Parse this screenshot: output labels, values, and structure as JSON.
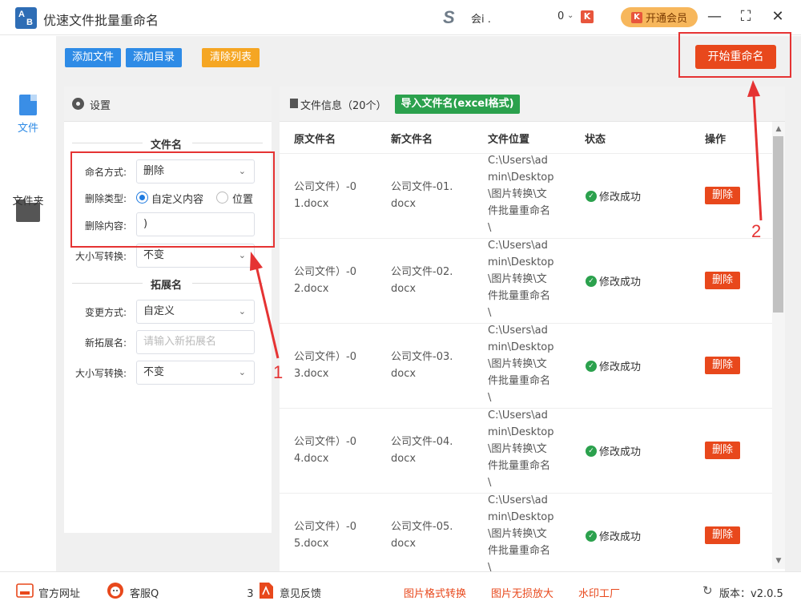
{
  "titlebar": {
    "title": "优速文件批量重命名",
    "logo_letters": [
      "A",
      "B"
    ],
    "user_text": "会i .",
    "message_count": "0",
    "vip_label": "开通会员",
    "badge_letter": "K"
  },
  "nav": {
    "items": [
      {
        "label": "文件",
        "icon": "file-icon",
        "active": true
      },
      {
        "label": "文件夹",
        "icon": "folder-icon",
        "active": false
      }
    ]
  },
  "toolbar": {
    "add_file": "添加文件",
    "add_folder": "添加目录",
    "clear_list": "清除列表",
    "start": "开始重命名"
  },
  "settings": {
    "title": "设置",
    "filename_section": "文件名",
    "naming_mode_label": "命名方式:",
    "naming_mode_value": "删除",
    "delete_type_label": "删除类型:",
    "delete_type_options": [
      "自定义内容",
      "位置"
    ],
    "delete_content_label": "删除内容:",
    "delete_content_value": ")",
    "case_label": "大小写转换:",
    "case_value": "不变",
    "ext_section": "拓展名",
    "change_mode_label": "变更方式:",
    "change_mode_value": "自定义",
    "new_ext_label": "新拓展名:",
    "new_ext_placeholder": "请输入新拓展名",
    "ext_case_label": "大小写转换:",
    "ext_case_value": "不变"
  },
  "fileinfo": {
    "title": "文件信息（20个）",
    "import_btn": "导入文件名(excel格式)",
    "columns": [
      "原文件名",
      "新文件名",
      "文件位置",
      "状态",
      "操作"
    ],
    "rows": [
      {
        "orig": [
          "公司文件）-0",
          "1.docx"
        ],
        "new": [
          "公司文件-01.",
          "docx"
        ],
        "path": [
          "C:\\Users\\ad",
          "min\\Desktop",
          "\\图片转换\\文",
          "件批量重命名",
          "\\"
        ],
        "status": "修改成功",
        "action": "删除"
      },
      {
        "orig": [
          "公司文件）-0",
          "2.docx"
        ],
        "new": [
          "公司文件-02.",
          "docx"
        ],
        "path": [
          "C:\\Users\\ad",
          "min\\Desktop",
          "\\图片转换\\文",
          "件批量重命名",
          "\\"
        ],
        "status": "修改成功",
        "action": "删除"
      },
      {
        "orig": [
          "公司文件）-0",
          "3.docx"
        ],
        "new": [
          "公司文件-03.",
          "docx"
        ],
        "path": [
          "C:\\Users\\ad",
          "min\\Desktop",
          "\\图片转换\\文",
          "件批量重命名",
          "\\"
        ],
        "status": "修改成功",
        "action": "删除"
      },
      {
        "orig": [
          "公司文件）-0",
          "4.docx"
        ],
        "new": [
          "公司文件-04.",
          "docx"
        ],
        "path": [
          "C:\\Users\\ad",
          "min\\Desktop",
          "\\图片转换\\文",
          "件批量重命名",
          "\\"
        ],
        "status": "修改成功",
        "action": "删除"
      },
      {
        "orig": [
          "公司文件）-0",
          "5.docx"
        ],
        "new": [
          "公司文件-05.",
          "docx"
        ],
        "path": [
          "C:\\Users\\ad",
          "min\\Desktop",
          "\\图片转换\\文",
          "件批量重命名",
          "\\"
        ],
        "status": "修改成功",
        "action": "删除"
      }
    ]
  },
  "footer": {
    "website": "官方网址",
    "support": "客服Q",
    "support_tail": "3",
    "feedback": "意见反馈",
    "links": [
      "图片格式转换",
      "图片无损放大",
      "水印工厂"
    ],
    "version": "版本：v2.0.5"
  },
  "annotations": {
    "num1": "1",
    "num2": "2"
  },
  "colors": {
    "accent_blue": "#2e8be6",
    "orange": "#f5a623",
    "red": "#e8481c",
    "green": "#2ba14d",
    "annotation_red": "#e53333"
  }
}
